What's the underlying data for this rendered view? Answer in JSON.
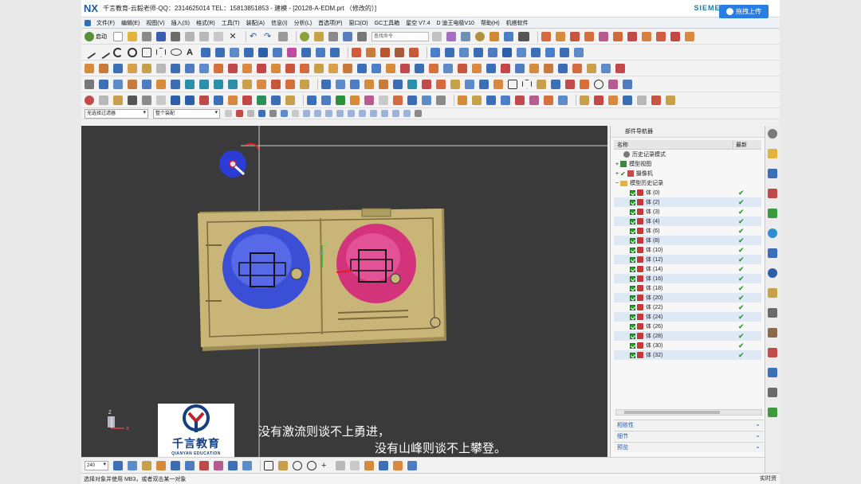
{
  "app": {
    "logo": "NX",
    "title": "千言教育-云毅老师-QQ：2314625014 TEL：15813851853 - 建模 - [20128-A-EDM.prt （修改的）]",
    "brand": "SIEMENS",
    "upload_label": "拖拽上传"
  },
  "menu": [
    "文件(F)",
    "编辑(E)",
    "视图(V)",
    "插入(S)",
    "格式(R)",
    "工具(T)",
    "装配(A)",
    "信息(I)",
    "分析(L)",
    "首选项(P)",
    "窗口(O)",
    "GC工具箱",
    "星空 V7.4",
    "D 迪王电极V10",
    "帮助(H)",
    "机搭软件"
  ],
  "toolbar": {
    "start_label": "启动",
    "search_placeholder": "查找命令",
    "filter_select": "无选择过滤器",
    "scope_select": "整个装配",
    "zoom_value": "240"
  },
  "navigator": {
    "title": "部件导航器",
    "col_name": "名称",
    "col_latest": "最新",
    "nodes": [
      {
        "label": "历史记录模式"
      },
      {
        "label": "模型视图"
      },
      {
        "label": "摄像机"
      },
      {
        "label": "模型历史记录"
      }
    ],
    "bodies": [
      {
        "label": "体 (0)",
        "ok": "✔"
      },
      {
        "label": "体 (2)",
        "ok": "✔"
      },
      {
        "label": "体 (3)",
        "ok": "✔"
      },
      {
        "label": "体 (4)",
        "ok": "✔"
      },
      {
        "label": "体 (6)",
        "ok": "✔"
      },
      {
        "label": "体 (8)",
        "ok": "✔"
      },
      {
        "label": "体 (10)",
        "ok": "✔"
      },
      {
        "label": "体 (12)",
        "ok": "✔"
      },
      {
        "label": "体 (14)",
        "ok": "✔"
      },
      {
        "label": "体 (16)",
        "ok": "✔"
      },
      {
        "label": "体 (18)",
        "ok": "✔"
      },
      {
        "label": "体 (20)",
        "ok": "✔"
      },
      {
        "label": "体 (22)",
        "ok": "✔"
      },
      {
        "label": "体 (24)",
        "ok": "✔"
      },
      {
        "label": "体 (26)",
        "ok": "✔"
      },
      {
        "label": "体 (28)",
        "ok": "✔"
      },
      {
        "label": "体 (30)",
        "ok": "✔"
      },
      {
        "label": "体 (32)",
        "ok": "✔"
      }
    ],
    "sections": [
      "相依性",
      "细节",
      "预览"
    ]
  },
  "viewport": {
    "axis_yc": "YC",
    "axis_zc": "ZC",
    "axis_xc": "XC",
    "axis_z": "Z",
    "axis_x": "X",
    "subtitle_line1": "没有激流则谈不上勇进，",
    "subtitle_line2": "没有山峰则谈不上攀登。",
    "logo_cn": "千言教育",
    "logo_en": "QIANYAN EDUCATION"
  },
  "status": {
    "message": "选择对象并使用 MB3，或者双击某一对象",
    "mode": "实时资"
  },
  "colors": {
    "viewport_bg": "#3a3a3a",
    "mold_plate": "#c9b577",
    "blue_body": "#3b4fd6",
    "magenta_body": "#d2337a",
    "accent": "#2a7de1"
  }
}
